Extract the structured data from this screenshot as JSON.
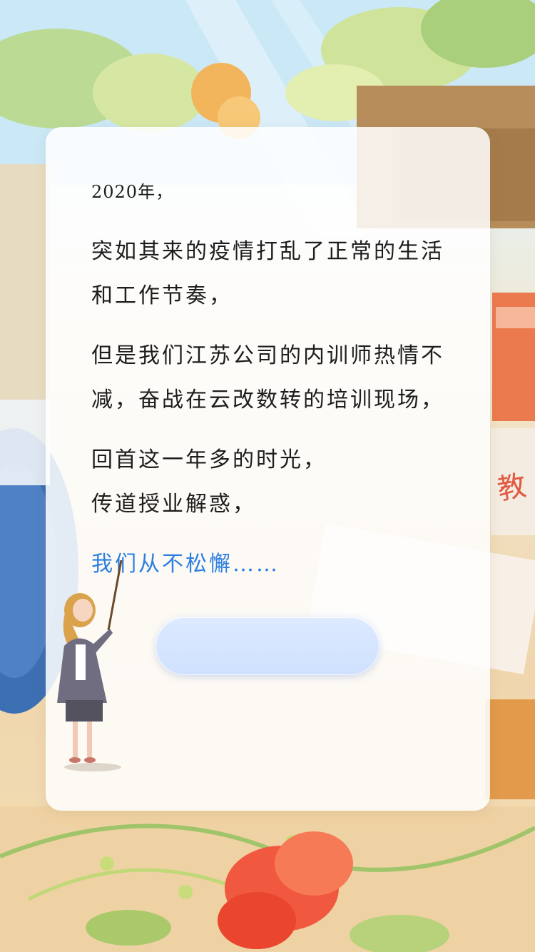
{
  "letter": {
    "year_line": "2020年，",
    "paragraph1": [
      "突如其来的疫情打乱了正常的生活",
      "和工作节奏，"
    ],
    "paragraph2": [
      "但是我们江苏公司的内训师热情不",
      "减，奋战在云改数转的培训现场，"
    ],
    "paragraph3": [
      "回首这一年多的时光，",
      "传道授业解惑，"
    ],
    "closing": "我们从不松懈……"
  },
  "colors": {
    "accent_text": "#2d7fe0",
    "button": "#d6e6ff",
    "card": "#ffffff"
  }
}
